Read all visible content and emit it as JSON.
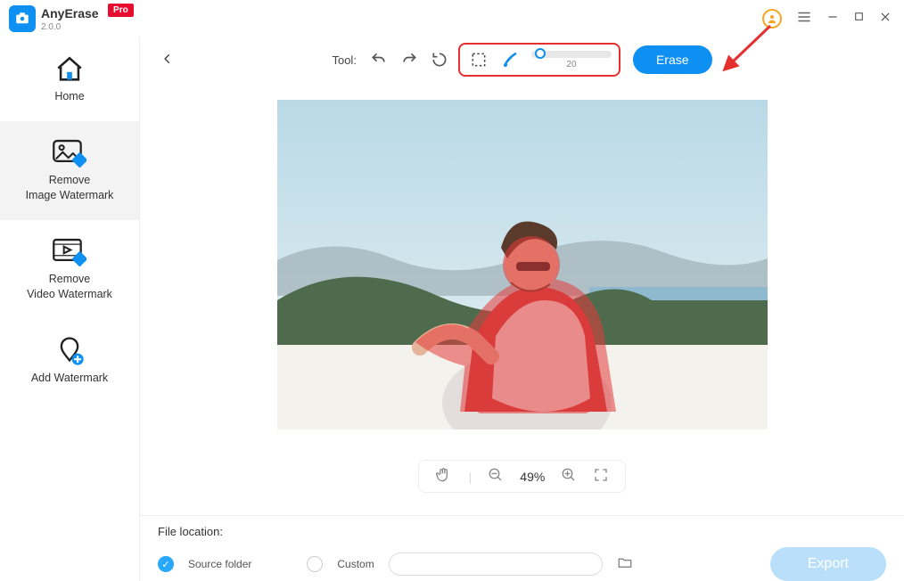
{
  "app": {
    "name": "AnyErase",
    "version": "2.0.0",
    "pro_badge": "Pro"
  },
  "sidebar": {
    "items": [
      {
        "label": "Home"
      },
      {
        "label_line1": "Remove",
        "label_line2": "Image Watermark"
      },
      {
        "label_line1": "Remove",
        "label_line2": "Video Watermark"
      },
      {
        "label": "Add Watermark"
      }
    ]
  },
  "toolbar": {
    "tool_label": "Tool:",
    "slider_value": "20",
    "erase_label": "Erase"
  },
  "canvas": {
    "zoom_percent": "49%"
  },
  "bottom": {
    "file_location_label": "File location:",
    "source_radio_label": "Source folder",
    "custom_radio_label": "Custom",
    "export_label": "Export"
  }
}
